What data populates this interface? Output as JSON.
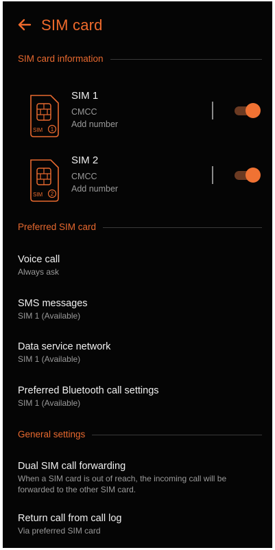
{
  "app_bar": {
    "title": "SIM card"
  },
  "colors": {
    "accent": "#ef6a2c",
    "background": "#050505",
    "primary_text": "#f0f0f0",
    "secondary_text": "#9a9a9a"
  },
  "icons": {
    "back": "arrow-left-icon",
    "sim": "sim-card-icon"
  },
  "sections": {
    "sim_info": {
      "header": "SIM card information"
    },
    "preferred": {
      "header": "Preferred SIM card"
    },
    "general": {
      "header": "General settings"
    }
  },
  "sims": [
    {
      "name": "SIM 1",
      "carrier": "CMCC",
      "add_number": "Add number",
      "badge": "SIM",
      "index": "1",
      "enabled": true
    },
    {
      "name": "SIM 2",
      "carrier": "CMCC",
      "add_number": "Add number",
      "badge": "SIM",
      "index": "2",
      "enabled": true
    }
  ],
  "preferred_items": [
    {
      "title": "Voice call",
      "subtitle": "Always ask"
    },
    {
      "title": "SMS messages",
      "subtitle": "SIM 1 (Available)"
    },
    {
      "title": "Data service network",
      "subtitle": "SIM 1 (Available)"
    },
    {
      "title": "Preferred Bluetooth call settings",
      "subtitle": "SIM 1 (Available)"
    }
  ],
  "general_items": [
    {
      "title": "Dual SIM call forwarding",
      "subtitle_line1": "When a SIM card is out of reach, the incoming call will be",
      "subtitle_line2": "forwarded to the other SIM card."
    },
    {
      "title": "Return call from call log",
      "subtitle": "Via preferred SIM card"
    }
  ]
}
